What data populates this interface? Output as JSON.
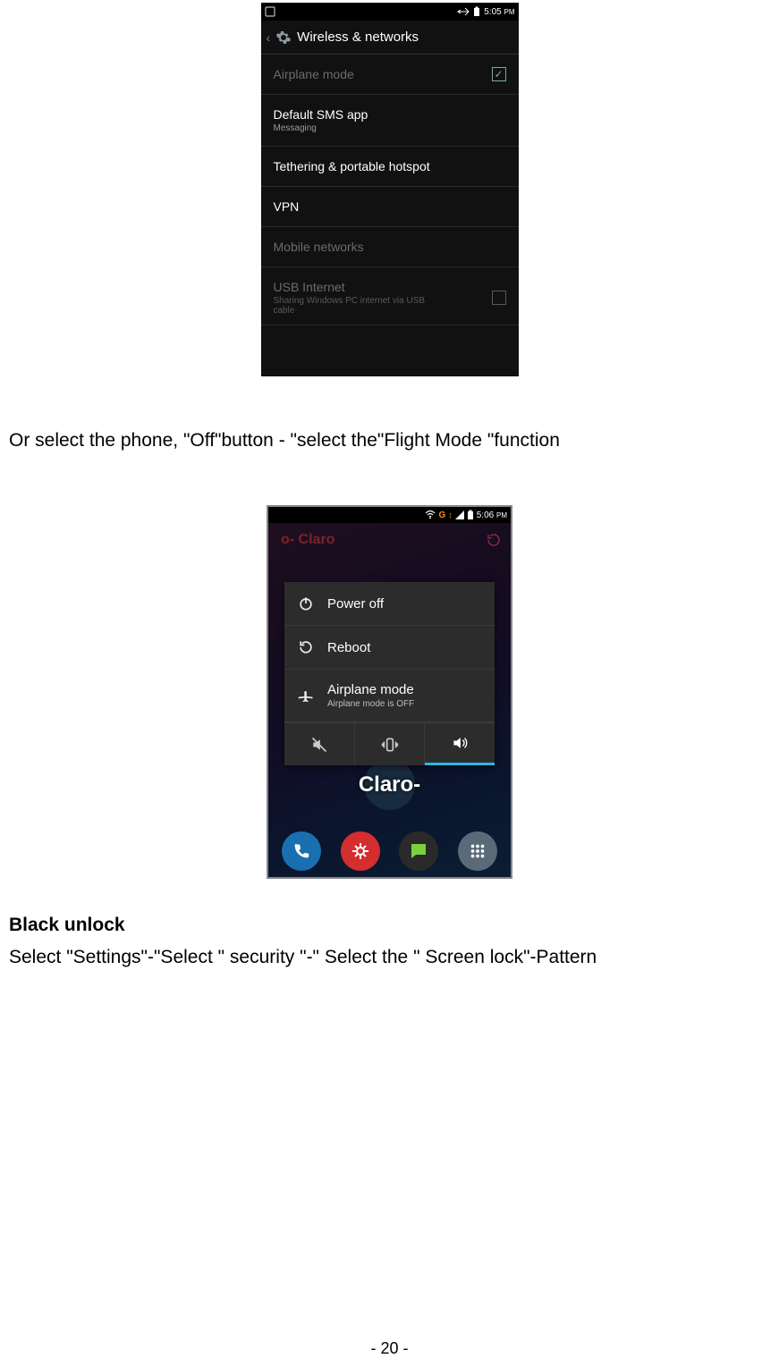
{
  "phone1": {
    "statusbar": {
      "time": "5:05",
      "ampm": "PM"
    },
    "title": "Wireless & networks",
    "items": [
      {
        "label": "Airplane mode",
        "sub": "",
        "disabled": true,
        "checkbox": "checked"
      },
      {
        "label": "Default SMS app",
        "sub": "Messaging",
        "disabled": false
      },
      {
        "label": "Tethering & portable hotspot",
        "sub": "",
        "disabled": false
      },
      {
        "label": "VPN",
        "sub": "",
        "disabled": false
      },
      {
        "label": "Mobile networks",
        "sub": "",
        "disabled": true
      },
      {
        "label": "USB Internet",
        "sub": "Sharing Windows PC internet via USB cable",
        "disabled": true,
        "checkbox": "unchecked"
      }
    ]
  },
  "caption1": "Or select the phone, \"Off\"button - \"select the\"Flight Mode \"function",
  "phone2": {
    "statusbar": {
      "g": "G",
      "arrows": "↕",
      "time": "5:06",
      "ampm": "PM"
    },
    "brand": "Claro",
    "menu": {
      "poweroff": "Power off",
      "reboot": "Reboot",
      "airplane": "Airplane mode",
      "airplane_sub": "Airplane mode is OFF"
    },
    "midBrand": "Claro-"
  },
  "heading": "Black unlock",
  "caption2": "Select \"Settings\"-\"Select \" security \"-\" Select the \" Screen lock\"-Pattern",
  "pagenum": "- 20 -"
}
